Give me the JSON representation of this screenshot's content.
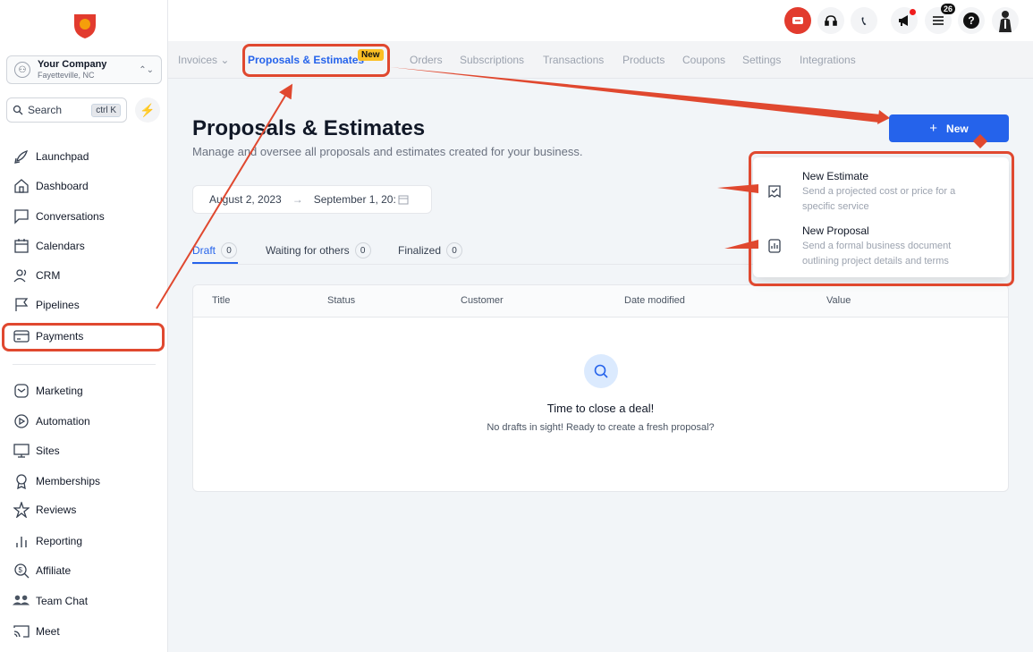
{
  "company": {
    "name": "Your Company",
    "location": "Fayetteville, NC"
  },
  "search": {
    "label": "Search",
    "shortcut": "ctrl K"
  },
  "nav": [
    {
      "label": "Launchpad",
      "icon": "rocket-icon"
    },
    {
      "label": "Dashboard",
      "icon": "home-icon"
    },
    {
      "label": "Conversations",
      "icon": "chat-icon"
    },
    {
      "label": "Calendars",
      "icon": "calendar-icon"
    },
    {
      "label": "CRM",
      "icon": "users-icon"
    },
    {
      "label": "Pipelines",
      "icon": "flag-icon"
    },
    {
      "label": "Payments",
      "icon": "card-icon"
    },
    {
      "label": "Marketing",
      "icon": "mail-icon"
    },
    {
      "label": "Automation",
      "icon": "play-icon"
    },
    {
      "label": "Sites",
      "icon": "monitor-icon"
    },
    {
      "label": "Memberships",
      "icon": "award-icon"
    },
    {
      "label": "Reviews",
      "icon": "star-icon"
    },
    {
      "label": "Reporting",
      "icon": "bar-chart-icon"
    },
    {
      "label": "Affiliate",
      "icon": "dollar-search-icon"
    },
    {
      "label": "Team Chat",
      "icon": "team-icon"
    },
    {
      "label": "Meet",
      "icon": "cast-icon"
    }
  ],
  "topbar": {
    "notification_count": "26"
  },
  "tabs": [
    {
      "label": "Invoices ⌄"
    },
    {
      "label": "Proposals & Estimates"
    },
    {
      "label": "Orders"
    },
    {
      "label": "Subscriptions"
    },
    {
      "label": "Transactions"
    },
    {
      "label": "Products"
    },
    {
      "label": "Coupons"
    },
    {
      "label": "Settings"
    },
    {
      "label": "Integrations"
    }
  ],
  "new_tag": "New",
  "page": {
    "title": "Proposals & Estimates",
    "subtitle": "Manage and oversee all proposals and estimates created for your business.",
    "date_from": "August 2, 2023",
    "date_to": "September 1, 20:"
  },
  "status_tabs": [
    {
      "label": "Draft",
      "count": "0"
    },
    {
      "label": "Waiting for others",
      "count": "0"
    },
    {
      "label": "Finalized",
      "count": "0"
    }
  ],
  "table": {
    "columns": [
      "Title",
      "Status",
      "Customer",
      "Date modified",
      "Value"
    ],
    "empty_title": "Time to close a deal!",
    "empty_subtitle": "No drafts in sight! Ready to create a fresh proposal?"
  },
  "new_button": {
    "plus": "+",
    "label": "New"
  },
  "dropdown": [
    {
      "title": "New Estimate",
      "desc": "Send a projected cost or price for a specific service"
    },
    {
      "title": "New Proposal",
      "desc": "Send a formal business document outlining project details and terms"
    }
  ],
  "colors": {
    "accent": "#2563eb",
    "annotation": "#e0482f",
    "tag": "#fbbf24"
  }
}
